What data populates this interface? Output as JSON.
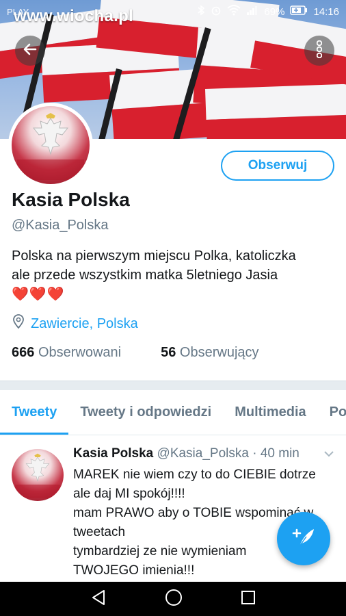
{
  "status_bar": {
    "carrier": "PLAY",
    "battery": "69%",
    "time": "14:16"
  },
  "watermark": "www.wiocha.pl",
  "profile": {
    "follow_label": "Obserwuj",
    "name": "Kasia Polska",
    "handle": "@Kasia_Polska",
    "bio_line1": "Polska na pierwszym miejscu  Polka, katoliczka",
    "bio_line2": "ale przede wszystkim matka 5letniego Jasia",
    "bio_hearts": "❤️❤️❤️",
    "location": "Zawiercie, Polska",
    "following_count": "666",
    "following_label": "Obserwowani",
    "followers_count": "56",
    "followers_label": "Obserwujący"
  },
  "tabs": [
    {
      "label": "Tweety",
      "active": true
    },
    {
      "label": "Tweety i odpowiedzi",
      "active": false
    },
    {
      "label": "Multimedia",
      "active": false
    },
    {
      "label": "Po",
      "active": false
    }
  ],
  "tweet": {
    "author": "Kasia Polska",
    "handle": "@Kasia_Polska",
    "separator": "·",
    "time": "40 min",
    "lines": [
      "MAREK nie wiem czy to do CIEBIE dotrze",
      "ale daj MI spokój!!!!",
      "mam PRAWO aby o TOBIE wspominać w",
      "tweetach",
      "tymbardziej ze nie wymieniam",
      "TWOJEGO imienia!!!"
    ]
  },
  "colors": {
    "accent": "#1da1f2",
    "text": "#14171a",
    "muted": "#657786",
    "heart": "#d3202c"
  }
}
